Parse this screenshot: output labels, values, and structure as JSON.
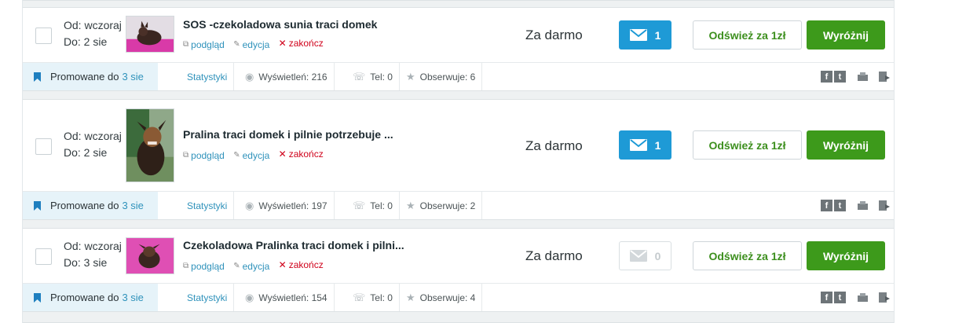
{
  "ads": [
    {
      "dates": {
        "from": "Od: wczoraj",
        "to": "Do: 2 sie"
      },
      "thumb_desc": "pink-dog-photo",
      "title": "SOS -czekoladowa sunia traci domek",
      "actions": {
        "preview": "podgląd",
        "edit": "edycja",
        "end": "zakończ"
      },
      "price": "Za darmo",
      "messages": "1",
      "refresh": "Odśwież za 1zł",
      "feature": "Wyróżnij",
      "promo": {
        "label": "Promowane do",
        "until": "3 sie"
      },
      "stats": {
        "link": "Statystyki",
        "views": "Wyświetleń: 216",
        "phone": "Tel: 0",
        "watch": "Obserwuje: 6"
      }
    },
    {
      "dates": {
        "from": "Od: wczoraj",
        "to": "Do: 2 sie"
      },
      "thumb_desc": "green-dog-photo",
      "title": "Pralina traci domek i pilnie potrzebuje ...",
      "actions": {
        "preview": "podgląd",
        "edit": "edycja",
        "end": "zakończ"
      },
      "price": "Za darmo",
      "messages": "1",
      "refresh": "Odśwież za 1zł",
      "feature": "Wyróżnij",
      "promo": {
        "label": "Promowane do",
        "until": "3 sie"
      },
      "stats": {
        "link": "Statystyki",
        "views": "Wyświetleń: 197",
        "phone": "Tel: 0",
        "watch": "Obserwuje: 2"
      }
    },
    {
      "dates": {
        "from": "Od: wczoraj",
        "to": "Do: 3 sie"
      },
      "thumb_desc": "pink-dog-photo",
      "title": "Czekoladowa Pralinka traci domek i pilni...",
      "actions": {
        "preview": "podgląd",
        "edit": "edycja",
        "end": "zakończ"
      },
      "price": "Za darmo",
      "messages": "0",
      "refresh": "Odśwież za 1zł",
      "feature": "Wyróżnij",
      "promo": {
        "label": "Promowane do",
        "until": "3 sie"
      },
      "stats": {
        "link": "Statystyki",
        "views": "Wyświetleń: 154",
        "phone": "Tel: 0",
        "watch": "Obserwuje: 4"
      }
    }
  ],
  "social": {
    "facebook": "f",
    "twitter": "t"
  },
  "colors": {
    "accent_blue": "#1e9ad6",
    "feature_green": "#3d9a1b",
    "link_blue": "#2f92bb",
    "end_red": "#d0021b",
    "promo_bg": "#e6f3f9"
  }
}
